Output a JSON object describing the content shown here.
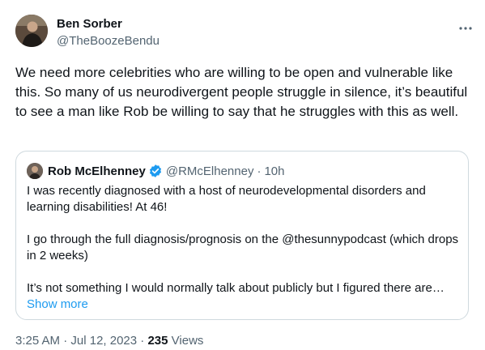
{
  "tweet": {
    "author_name": "Ben Sorber",
    "author_handle": "@TheBoozeBendu",
    "text": "We need more celebrities who are willing to be open and vulnerable like this. So many of us neurodivergent people struggle in silence, it’s beautiful to see a man like Rob be willing to say that he struggles with this as well.",
    "time": "3:25 AM",
    "date": "Jul 12, 2023",
    "views_count": "235",
    "views_label": "Views",
    "separator": "·",
    "more_icon": "more-horizontal-icon"
  },
  "quoted": {
    "author_name": "Rob McElhenney",
    "verified_icon": "verified-badge-icon",
    "author_handle": "@RMcElhenney",
    "separator": "·",
    "time": "10h",
    "paragraphs": [
      "I was recently diagnosed with a host of neurodevelopmental disorders and learning disabilities! At 46!",
      "I go through the full diagnosis/prognosis on the @thesunnypodcast (which drops in 2 weeks)",
      "It’s not something I would normally talk about publicly but I figured there are…"
    ],
    "show_more": "Show more"
  },
  "colors": {
    "text": "#0f1419",
    "secondary": "#536471",
    "accent": "#1d9bf0",
    "border": "#cfd9de"
  }
}
